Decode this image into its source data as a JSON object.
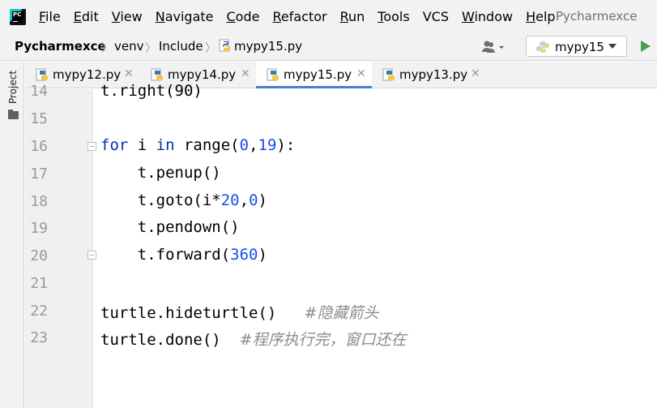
{
  "menubar": {
    "items": [
      {
        "u": "F",
        "rest": "ile"
      },
      {
        "u": "E",
        "rest": "dit"
      },
      {
        "u": "V",
        "rest": "iew"
      },
      {
        "u": "N",
        "rest": "avigate"
      },
      {
        "u": "C",
        "rest": "ode"
      },
      {
        "u": "R",
        "rest": "efactor"
      },
      {
        "u": "R",
        "rest": "un"
      },
      {
        "u": "T",
        "rest": "ools"
      },
      {
        "u": "",
        "rest": "VCS"
      },
      {
        "u": "W",
        "rest": "indow"
      },
      {
        "u": "H",
        "rest": "elp"
      }
    ],
    "title": "Pycharmexce"
  },
  "breadcrumb": {
    "project": "Pycharmexce",
    "folder1": "venv",
    "folder2": "Include",
    "file": "mypy15.py"
  },
  "run_config": {
    "label": "mypy15"
  },
  "toolstrip": {
    "project_label": "Project"
  },
  "tabs": [
    {
      "label": "mypy12.py",
      "active": false
    },
    {
      "label": "mypy14.py",
      "active": false
    },
    {
      "label": "mypy15.py",
      "active": true
    },
    {
      "label": "mypy13.py",
      "active": false
    }
  ],
  "editor": {
    "line_numbers": [
      "14",
      "15",
      "16",
      "17",
      "18",
      "19",
      "20",
      "21",
      "22",
      "23"
    ],
    "lines": {
      "l14": {
        "text": "t.right(90)"
      },
      "l16": {
        "kw1": "for",
        "t1": " i ",
        "kw2": "in",
        "t2": " range(",
        "n1": "0",
        "t3": ",",
        "n2": "19",
        "t4": "):"
      },
      "l17": {
        "text": "    t.penup()"
      },
      "l18": {
        "t1": "    t.goto(i*",
        "n1": "20",
        "t2": ",",
        "n2": "0",
        "t3": ")"
      },
      "l19": {
        "text": "    t.pendown()"
      },
      "l20": {
        "t1": "    t.forward(",
        "n1": "360",
        "t2": ")"
      },
      "l22": {
        "code": "turtle.hideturtle()   ",
        "comment": "#隐藏箭头"
      },
      "l23": {
        "code": "turtle.done()  ",
        "comment": "#程序执行完，窗口还在"
      }
    }
  },
  "colors": {
    "keyword": "#0033b3",
    "number": "#1750eb",
    "comment": "#8c8c8c",
    "active_tab_underline": "#4083c9"
  }
}
